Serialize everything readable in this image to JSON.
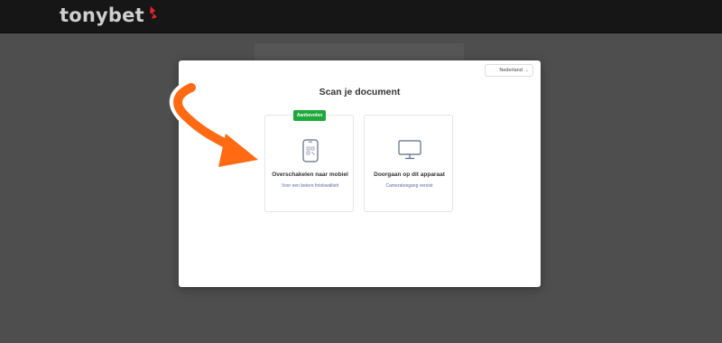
{
  "header": {
    "logo_text": "tonybet",
    "logo_mark_color": "#e8242b"
  },
  "modal": {
    "language_select": {
      "value": "Nederland",
      "icon": "chevron-down-icon"
    },
    "title": "Scan je document",
    "options": [
      {
        "badge": "Aanbevolen",
        "icon": "phone-qr-icon",
        "title": "Overschakelen naar mobiel",
        "subtitle": "Voor een betere fotokwaliteit"
      },
      {
        "icon": "monitor-icon",
        "title": "Doorgaan op dit apparaat",
        "subtitle": "Cameratoegang vereist"
      }
    ]
  },
  "annotation": {
    "arrow_color": "#ff6a13"
  },
  "colors": {
    "badge_green": "#1fa83a",
    "subtitle_blue": "#5a6ea0",
    "topbar": "#161616",
    "overlay": "#4e4e4e"
  }
}
